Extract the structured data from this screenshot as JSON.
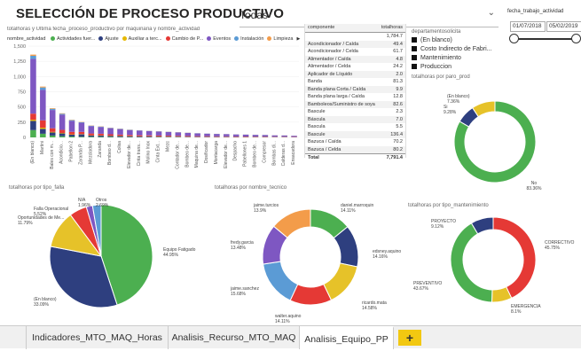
{
  "title": "SELECCIÓN DE PROCESO PRODUCTIVO",
  "filter": {
    "value": "Todas"
  },
  "date_filter": {
    "label": "fecha_trabajo_actividad",
    "start": "01/07/2018",
    "end": "05/02/2019"
  },
  "bar_chart": {
    "subtitle": "totalhoras y Última fecha_proceso_productivo por maquinaria y nombre_actividad",
    "legend_title": "nombre_actividad",
    "legend": [
      {
        "label": "Actividades fuer...",
        "color": "#4caf50"
      },
      {
        "label": "Ajuste",
        "color": "#2e3f7f"
      },
      {
        "label": "Auxiliar a terc...",
        "color": "#e6b800"
      },
      {
        "label": "Cambio de P...",
        "color": "#e53935"
      },
      {
        "label": "Eventos",
        "color": "#7e57c2"
      },
      {
        "label": "Instalación",
        "color": "#5b9bd5"
      },
      {
        "label": "Limpieza",
        "color": "#f39c4a"
      }
    ]
  },
  "chart_data": [
    {
      "type": "bar",
      "ylim": [
        0,
        1500
      ],
      "yticks": [
        "1,500",
        "1,250",
        "1,000",
        "750",
        "500",
        "250",
        "0"
      ],
      "categories": [
        "(En blanco)",
        "Martini",
        "Bales con m...",
        "Acondicio...",
        "Pabellon 2",
        "Zaranda P...",
        "Mezcladora",
        "Zaranda",
        "Bombeo d...",
        "Colisa",
        "Elevador de...",
        "Cinta trans...",
        "Molino Inox",
        "Cinta Ext...",
        "Mezc",
        "Contador de...",
        "Bombeo de...",
        "Maquina de...",
        "Dosificador",
        "Montacarga",
        "Elevador de...",
        "Despacho",
        "Pabellones 1",
        "Bombeo de...",
        "Compresor",
        "Bombas di...",
        "Calderas d...",
        "Ensacadora"
      ],
      "series": [
        {
          "name": "Actividades fuer...",
          "values": [
            120,
            60,
            30,
            20,
            15,
            10,
            10,
            8,
            8,
            6,
            6,
            5,
            5,
            5,
            4,
            4,
            4,
            3,
            3,
            3,
            3,
            2,
            2,
            2,
            2,
            2,
            2,
            1
          ]
        },
        {
          "name": "Ajuste",
          "values": [
            150,
            80,
            50,
            45,
            30,
            40,
            20,
            20,
            15,
            15,
            12,
            10,
            10,
            8,
            8,
            8,
            6,
            6,
            6,
            5,
            5,
            5,
            4,
            4,
            4,
            3,
            3,
            2
          ]
        },
        {
          "name": "Auxiliar a terc...",
          "values": [
            20,
            20,
            10,
            8,
            6,
            5,
            4,
            4,
            3,
            3,
            2,
            2,
            2,
            2,
            2,
            2,
            1,
            1,
            1,
            1,
            1,
            1,
            1,
            1,
            1,
            1,
            1,
            1
          ]
        },
        {
          "name": "Cambio de P...",
          "values": [
            100,
            120,
            60,
            50,
            40,
            35,
            30,
            28,
            25,
            22,
            20,
            18,
            16,
            15,
            14,
            12,
            12,
            10,
            10,
            9,
            8,
            8,
            7,
            6,
            6,
            5,
            5,
            4
          ]
        },
        {
          "name": "Eventos",
          "values": [
            900,
            500,
            300,
            250,
            180,
            150,
            120,
            110,
            100,
            90,
            80,
            75,
            70,
            65,
            60,
            55,
            50,
            45,
            40,
            38,
            35,
            32,
            30,
            28,
            25,
            22,
            20,
            18
          ]
        },
        {
          "name": "Instalación",
          "values": [
            50,
            40,
            20,
            15,
            12,
            10,
            8,
            8,
            6,
            6,
            5,
            5,
            4,
            4,
            4,
            3,
            3,
            3,
            3,
            2,
            2,
            2,
            2,
            2,
            2,
            1,
            1,
            1
          ]
        },
        {
          "name": "Limpieza",
          "values": [
            20,
            15,
            10,
            8,
            6,
            5,
            4,
            4,
            3,
            3,
            3,
            2,
            2,
            2,
            2,
            2,
            2,
            1,
            1,
            1,
            1,
            1,
            1,
            1,
            1,
            1,
            1,
            1
          ]
        }
      ]
    },
    {
      "type": "table",
      "columns": [
        "componente",
        "totalhoras"
      ],
      "rows": [
        [
          "",
          "1,784.7"
        ],
        [
          "Acondicionador / Caída",
          "49.4"
        ],
        [
          "Acondicionador / Celda",
          "61.7"
        ],
        [
          "Alimentador / Caída",
          "4.8"
        ],
        [
          "Alimentador / Celda",
          "24.2"
        ],
        [
          "Aplicador de Líquido",
          "2.0"
        ],
        [
          "Banda",
          "81.3"
        ],
        [
          "Banda plana Corta / Caída",
          "9.9"
        ],
        [
          "Banda plana larga / Caída",
          "12.8"
        ],
        [
          "Bamboleos/Suministro de soya",
          "82.6"
        ],
        [
          "Bascule",
          "2.3"
        ],
        [
          "Báscula",
          "7.0"
        ],
        [
          "Bascula",
          "5.5"
        ],
        [
          "Bascule",
          "136.4"
        ],
        [
          "Bazuca / Caída",
          "70.2"
        ],
        [
          "Bazuca / Celda",
          "80.2"
        ]
      ],
      "total_label": "Total",
      "total": "7,791.4"
    },
    {
      "type": "pie",
      "title": "totalhoras por tipo_falla",
      "slices": [
        {
          "label": "Equipo Fatigado",
          "pct": "44.95%",
          "value": 44.95,
          "color": "#4caf50"
        },
        {
          "label": "(En blanco)",
          "pct": "33.09%",
          "value": 33.09,
          "color": "#2e3f7f"
        },
        {
          "label": "Oportunidades de Me...",
          "pct": "11.79%",
          "value": 11.79,
          "color": "#e6c229"
        },
        {
          "label": "Falla Operacional",
          "pct": "5.52%",
          "value": 5.52,
          "color": "#e53935"
        },
        {
          "label": "N/A",
          "pct": "1.96%",
          "value": 1.96,
          "color": "#7e57c2"
        },
        {
          "label": "Otros",
          "pct": "2.69%",
          "value": 2.69,
          "color": "#5b9bd5"
        }
      ]
    },
    {
      "type": "pie",
      "title": "totalhoras por nombre_tecnico",
      "slices": [
        {
          "label": "daniel.marroquin",
          "pct": "14.11%",
          "value": 14.11,
          "color": "#4caf50"
        },
        {
          "label": "edsney.aquino",
          "pct": "14.16%",
          "value": 14.16,
          "color": "#2e3f7f"
        },
        {
          "label": "ricardo.mata",
          "pct": "14.58%",
          "value": 14.58,
          "color": "#e6c229"
        },
        {
          "label": "walter.aquino",
          "pct": "14.11%",
          "value": 14.11,
          "color": "#e53935"
        },
        {
          "label": "jaime.sanchez",
          "pct": "15.68%",
          "value": 15.68,
          "color": "#5b9bd5"
        },
        {
          "label": "fredy.garcia",
          "pct": "13.48%",
          "value": 13.48,
          "color": "#7e57c2"
        },
        {
          "label": "jaime.turcios",
          "pct": "13.9%",
          "value": 13.9,
          "color": "#f39c4a"
        }
      ]
    },
    {
      "type": "pie",
      "title": "totalhoras por paro_prod",
      "slices": [
        {
          "label": "No",
          "pct": "83.36%",
          "value": 83.36,
          "color": "#4caf50"
        },
        {
          "label": "(En blanco)",
          "pct": "7.36%",
          "value": 7.36,
          "color": "#2e3f7f"
        },
        {
          "label": "Si",
          "pct": "9.28%",
          "value": 9.28,
          "color": "#e6c229"
        }
      ]
    },
    {
      "type": "pie",
      "title": "totalhoras por tipo_mantenimiento",
      "slices": [
        {
          "label": "CORRECTIVO",
          "pct": "45.75%",
          "value": 45.75,
          "color": "#e53935"
        },
        {
          "label": "EMERGENCIA",
          "pct": "8.1%",
          "value": 8.1,
          "color": "#e6c229"
        },
        {
          "label": "PREVENTIVO",
          "pct": "43.67%",
          "value": 43.67,
          "color": "#4caf50"
        },
        {
          "label": "PROYECTO",
          "pct": "9.12%",
          "value": 9.12,
          "color": "#2e3f7f"
        }
      ]
    }
  ],
  "dept_legend": {
    "title": "departamentosolicita",
    "items": [
      "(En blanco)",
      "Costo Indirecto de Fabri...",
      "Mantenimiento",
      "Produccion"
    ]
  },
  "tabs": [
    {
      "label": "Indicadores_MTO_MAQ_Horas"
    },
    {
      "label": "Analisis_Recurso_MTO_MAQ"
    },
    {
      "label": "Analisis_Equipo_PP"
    }
  ],
  "add_tab": "+"
}
